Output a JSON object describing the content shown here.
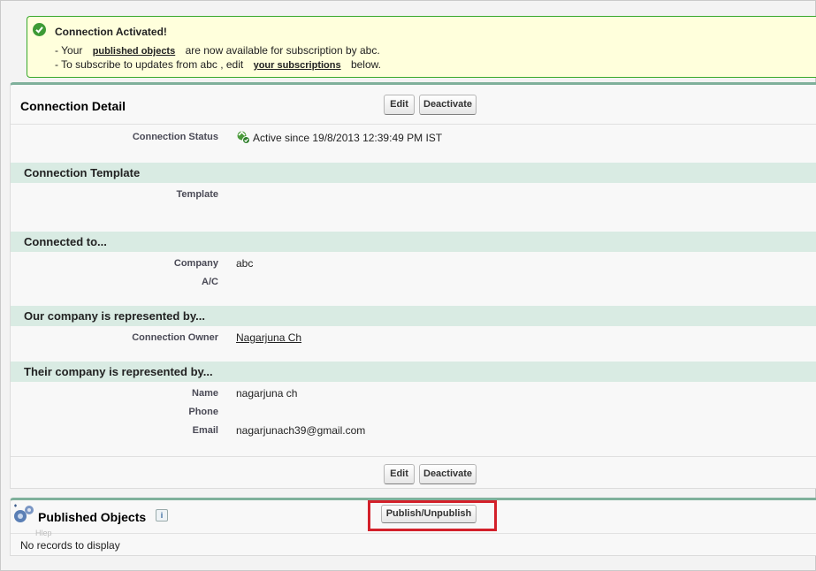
{
  "message": {
    "title": "Connection Activated!",
    "line1_prefix": "- Your",
    "line1_link": "published objects",
    "line1_suffix": "are now available for subscription by abc.",
    "line2_prefix": "- To subscribe to updates from abc , edit",
    "line2_link": "your subscriptions",
    "line2_suffix": "below."
  },
  "detail": {
    "title": "Connection Detail",
    "edit_label": "Edit",
    "deactivate_label": "Deactivate",
    "connection_status_label": "Connection Status",
    "connection_status_value": "Active since 19/8/2013 12:39:49 PM IST",
    "sections": {
      "template": "Connection Template",
      "connected_to": "Connected to...",
      "our_company": "Our company is represented by...",
      "their_company": "Their company is represented by..."
    },
    "template_label": "Template",
    "company_label": "Company",
    "company_value": "abc",
    "ac_label": "A/C",
    "owner_label": "Connection Owner",
    "owner_value": "Nagarjuna Ch",
    "name_label": "Name",
    "name_value": "nagarjuna ch",
    "phone_label": "Phone",
    "email_label": "Email",
    "email_value": "nagarjunach39@gmail.com"
  },
  "published": {
    "title": "Published Objects",
    "help_glyph": "i",
    "publish_label": "Publish/Unpublish",
    "ghost_text": "Hlep",
    "empty_text": "No records to display"
  },
  "colors": {
    "accent_border": "#7fb09b",
    "section_bg": "#d9ebe3",
    "message_bg": "#ffffdc",
    "message_border": "#39a82c",
    "highlight": "#d3202a"
  },
  "icons": [
    "check-icon",
    "active-status-icon",
    "published-objects-icon",
    "help-icon"
  ]
}
